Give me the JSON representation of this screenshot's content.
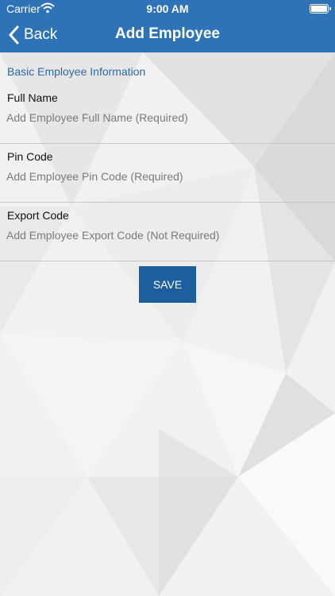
{
  "status_bar": {
    "carrier": "Carrier",
    "time": "9:00 AM"
  },
  "nav": {
    "back_label": "Back",
    "title": "Add Employee"
  },
  "form": {
    "section_title": "Basic Employee Information",
    "fields": [
      {
        "label": "Full Name",
        "placeholder": "Add Employee Full Name (Required)",
        "value": ""
      },
      {
        "label": "Pin Code",
        "placeholder": "Add Employee Pin Code (Required)",
        "value": ""
      },
      {
        "label": "Export Code",
        "placeholder": "Add Employee Export Code (Not Required)",
        "value": ""
      }
    ],
    "save_label": "SAVE"
  },
  "colors": {
    "nav_bar": "#2e73b8",
    "save_button": "#1d5e9e",
    "section_title": "#2e6aa6"
  }
}
